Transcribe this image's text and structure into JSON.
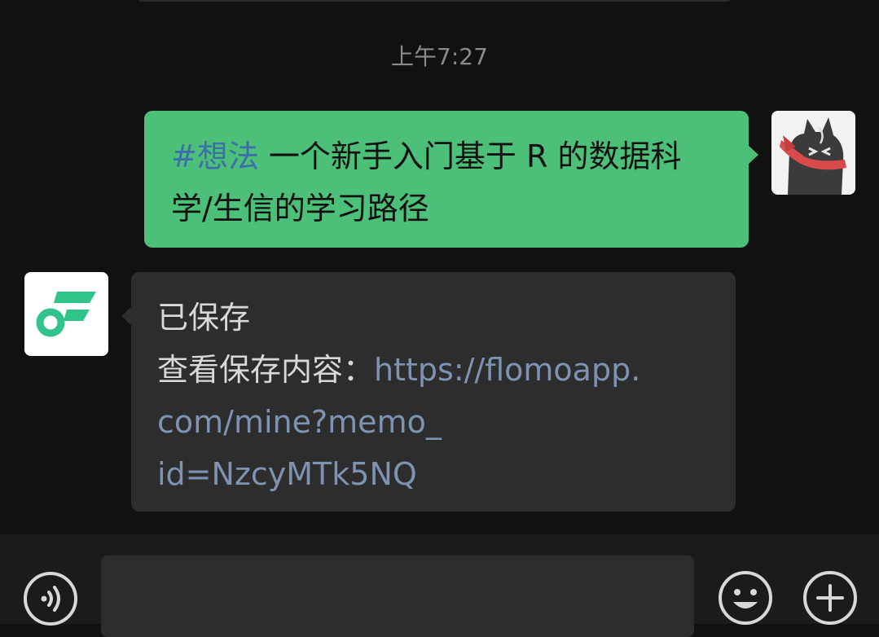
{
  "timestamp": "上午7:27",
  "messages": [
    {
      "sender": "self",
      "tag": "#想法",
      "text_line1": " 一个新手入门基于 R 的数据科",
      "text_line2": "学/生信的学习路径"
    },
    {
      "sender": "bot",
      "line1": "已保存",
      "line2_prefix": "查看保存内容：",
      "link_part1": "https://flomoapp.",
      "link_part2": "com/mine?memo_",
      "link_part3": "id=NzcyMTk5NQ"
    }
  ],
  "input": {
    "value": "",
    "placeholder": ""
  },
  "icons": {
    "voice": "voice-icon",
    "emoji": "emoji-icon",
    "plus": "plus-icon"
  },
  "colors": {
    "background": "#111111",
    "sent_bubble": "#4cbf78",
    "received_bubble": "#2d2d2d",
    "tag": "#3d6fa8",
    "link": "#7d93b1",
    "bot_logo": "#31c48a"
  }
}
